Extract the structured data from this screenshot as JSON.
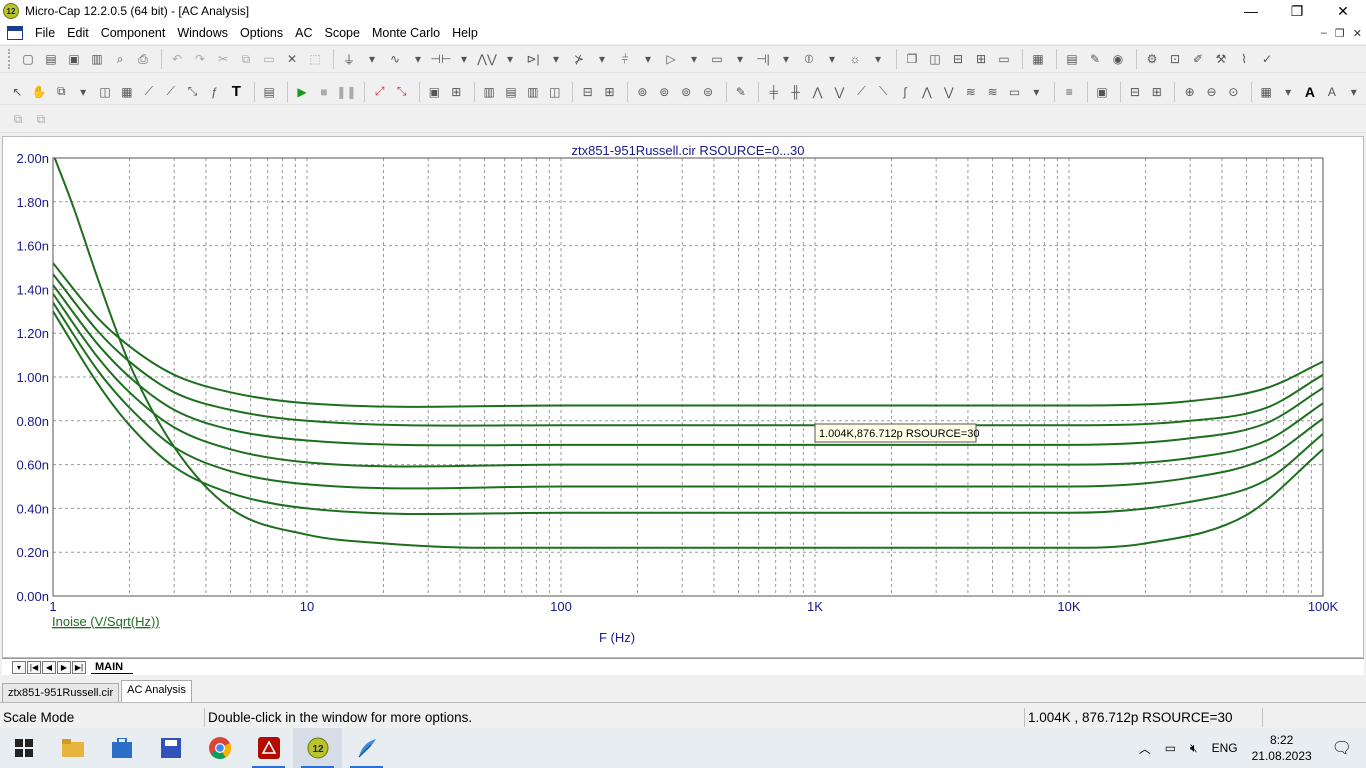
{
  "window": {
    "title": "Micro-Cap 12.2.0.5 (64 bit) - [AC Analysis]",
    "app_badge": "12"
  },
  "window_controls": {
    "minimize": "—",
    "restore": "❐",
    "close": "✕"
  },
  "mdi_controls": {
    "minimize": "–",
    "restore": "❐",
    "close": "✕"
  },
  "menu": [
    "File",
    "Edit",
    "Component",
    "Windows",
    "Options",
    "AC",
    "Scope",
    "Monte Carlo",
    "Help"
  ],
  "plot": {
    "title": "ztx851-951Russell.cir RSOURCE=0...30",
    "y_label": "Inoise (V/Sqrt(Hz))",
    "x_label": "F (Hz)",
    "tooltip": "1.004K,876.712p RSOURCE=30",
    "colors": {
      "curve": "#1e6e1e",
      "text": "#1a1a8c",
      "grid": "#9a9a9a"
    }
  },
  "chart_data": {
    "type": "line",
    "x_scale": "log",
    "xlim": [
      1,
      100000
    ],
    "ylim": [
      0,
      2e-09
    ],
    "x_ticks": [
      {
        "v": 1,
        "label": "1"
      },
      {
        "v": 10,
        "label": "10"
      },
      {
        "v": 100,
        "label": "100"
      },
      {
        "v": 1000,
        "label": "1K"
      },
      {
        "v": 10000,
        "label": "10K"
      },
      {
        "v": 100000,
        "label": "100K"
      }
    ],
    "y_ticks": [
      {
        "v": 0,
        "label": "0.00n"
      },
      {
        "v": 2e-10,
        "label": "0.20n"
      },
      {
        "v": 4e-10,
        "label": "0.40n"
      },
      {
        "v": 6e-10,
        "label": "0.60n"
      },
      {
        "v": 8e-10,
        "label": "0.80n"
      },
      {
        "v": 1e-09,
        "label": "1.00n"
      },
      {
        "v": 1.2e-09,
        "label": "1.20n"
      },
      {
        "v": 1.4e-09,
        "label": "1.40n"
      },
      {
        "v": 1.6e-09,
        "label": "1.60n"
      },
      {
        "v": 1.8e-09,
        "label": "1.80n"
      },
      {
        "v": 2e-09,
        "label": "2.00n"
      }
    ],
    "series": [
      {
        "x": [
          1,
          1.5,
          2,
          3,
          5,
          10,
          100,
          1000,
          10000,
          30000,
          60000,
          100000
        ],
        "y": [
          1.52e-09,
          1.27e-09,
          1.14e-09,
          1.01e-09,
          9.3e-10,
          8.8e-10,
          8.7e-10,
          8.7e-10,
          8.7e-10,
          8.9e-10,
          9.5e-10,
          1.07e-09
        ]
      },
      {
        "x": [
          1,
          1.5,
          2,
          3,
          5,
          10,
          100,
          1000,
          10000,
          30000,
          60000,
          100000
        ],
        "y": [
          1.47e-09,
          1.21e-09,
          1.07e-09,
          9.3e-10,
          8.5e-10,
          8e-10,
          7.8e-10,
          7.8e-10,
          7.8e-10,
          8e-10,
          8.6e-10,
          1.01e-09
        ]
      },
      {
        "x": [
          1,
          1.5,
          2,
          3,
          5,
          10,
          100,
          1000,
          10000,
          30000,
          60000,
          100000
        ],
        "y": [
          1.42e-09,
          1.15e-09,
          1e-09,
          8.5e-10,
          7.6e-10,
          7.1e-10,
          6.9e-10,
          6.9e-10,
          6.9e-10,
          7.2e-10,
          7.9e-10,
          9.5e-10
        ]
      },
      {
        "x": [
          1,
          1.5,
          2,
          3,
          5,
          10,
          100,
          1000,
          10000,
          30000,
          60000,
          100000
        ],
        "y": [
          1.38e-09,
          1.09e-09,
          9.3e-10,
          7.7e-10,
          6.7e-10,
          6.1e-10,
          6e-10,
          6e-10,
          6e-10,
          6.3e-10,
          7.1e-10,
          8.8e-10
        ]
      },
      {
        "x": [
          1,
          1.5,
          2,
          3,
          5,
          10,
          100,
          1000,
          10000,
          30000,
          60000,
          100000
        ],
        "y": [
          1.34e-09,
          1.03e-09,
          8.6e-10,
          6.8e-10,
          5.7e-10,
          5.1e-10,
          5e-10,
          5e-10,
          5e-10,
          5.4e-10,
          6.3e-10,
          8.1e-10
        ]
      },
      {
        "x": [
          1,
          1.5,
          2,
          3,
          5,
          10,
          100,
          1000,
          10000,
          30000,
          60000,
          100000
        ],
        "y": [
          1.3e-09,
          9.7e-10,
          7.8e-10,
          5.9e-10,
          4.7e-10,
          4e-10,
          3.8e-10,
          3.8e-10,
          3.8e-10,
          4.3e-10,
          5.3e-10,
          7.4e-10
        ]
      },
      {
        "x": [
          1,
          1.2,
          1.5,
          2,
          3,
          5,
          10,
          20,
          50,
          100,
          1000,
          10000,
          20000,
          50000,
          100000
        ],
        "y": [
          2.02e-09,
          1.78e-09,
          1.45e-09,
          1.06e-09,
          6.8e-10,
          4e-10,
          2.8e-10,
          2.4e-10,
          2.2e-10,
          2.2e-10,
          2.2e-10,
          2.2e-10,
          2.4e-10,
          3.7e-10,
          6.7e-10
        ]
      }
    ]
  },
  "main_tabs": {
    "page_tab": "MAIN"
  },
  "doc_tabs": [
    "ztx851-951Russell.cir",
    "AC Analysis"
  ],
  "status": {
    "mode": "Scale Mode",
    "hint": "Double-click in the window for more options.",
    "readout": "1.004K , 876.712p RSOURCE=30"
  },
  "taskbar": {
    "lang": "ENG",
    "time": "8:22",
    "date": "21.08.2023"
  }
}
